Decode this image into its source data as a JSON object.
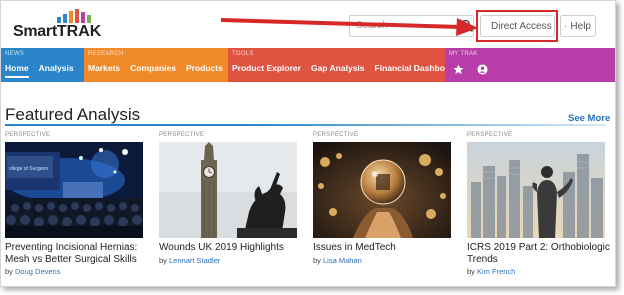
{
  "brand": {
    "name_part1": "Smart",
    "name_part2": "TRAK",
    "bar_colors": [
      "#2a86c8",
      "#f08a2a",
      "#df5340",
      "#b83da8",
      "#7ab648"
    ]
  },
  "header": {
    "search_placeholder": "Search",
    "direct_access_label": "Direct Access",
    "help_label": "Help",
    "highlight_color": "#d62828"
  },
  "nav": {
    "sections": [
      {
        "label": "NEWS",
        "color": "#2a86c8",
        "items": [
          "Home",
          "Analysis"
        ]
      },
      {
        "label": "RESEARCH",
        "color": "#f08a2a",
        "items": [
          "Markets",
          "Companies",
          "Products"
        ]
      },
      {
        "label": "TOOLS",
        "color": "#df5340",
        "items": [
          "Product Explorer",
          "Gap Analysis",
          "Financial Dashboard"
        ]
      },
      {
        "label": "MY TRAK",
        "color": "#b83da8",
        "icons": [
          "star-icon",
          "user-icon"
        ]
      }
    ]
  },
  "featured": {
    "title": "Featured Analysis",
    "see_more": "See More",
    "cards": [
      {
        "category": "PERSPECTIVE",
        "title": "Preventing Incisional Hernias: Mesh vs Better Surgical Skills",
        "by": "by",
        "author": "Doug Devens"
      },
      {
        "category": "PERSPECTIVE",
        "title": "Wounds UK 2019 Highlights",
        "by": "by",
        "author": "Lennart Stadler"
      },
      {
        "category": "PERSPECTIVE",
        "title": "Issues in MedTech",
        "by": "by",
        "author": "Lisa Mahan"
      },
      {
        "category": "PERSPECTIVE",
        "title": "ICRS 2019 Part 2: Orthobiologic Trends",
        "by": "by",
        "author": "Kim French"
      }
    ]
  }
}
